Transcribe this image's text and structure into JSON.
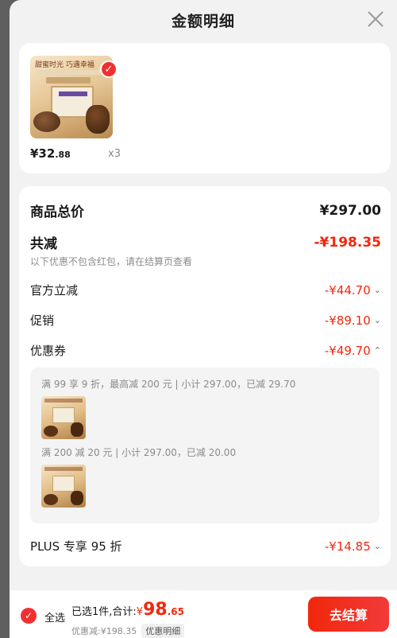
{
  "header": {
    "title": "金额明细"
  },
  "product": {
    "thumb_text": "甜蜜时光 巧遇幸福",
    "price_int": "¥32",
    "price_dec": ".88",
    "qty": "x3"
  },
  "breakdown": {
    "total_label": "商品总价",
    "total_value": "¥297.00",
    "reduce_label": "共减",
    "reduce_value": "-¥198.35",
    "note": "以下优惠不包含红包，请在结算页查看",
    "items": [
      {
        "label": "官方立减",
        "value": "-¥44.70",
        "chevron": "⌄"
      },
      {
        "label": "促销",
        "value": "-¥89.10",
        "chevron": "⌄"
      },
      {
        "label": "优惠券",
        "value": "-¥49.70",
        "chevron": "⌃"
      }
    ],
    "coupons": [
      {
        "line": "满 99 享 9 折，最高减 200 元 | 小计 297.00，已减 29.70"
      },
      {
        "line": "满 200 减 20 元 | 小计 297.00，已减 20.00"
      }
    ],
    "plus_label": "PLUS 专享 95 折",
    "plus_value": "-¥14.85",
    "plus_chevron": "⌄"
  },
  "footer": {
    "select_all": "全选",
    "selected_text": "已选1件,合计:",
    "currency": "¥",
    "total_int": "98",
    "total_dec": ".65",
    "discount_text": "优惠减:¥198.35",
    "detail_link": "优惠明细",
    "checkout_label": "去结算"
  },
  "colors": {
    "accent_red": "#f2270c",
    "sheet_bg": "#f2f2f2"
  }
}
